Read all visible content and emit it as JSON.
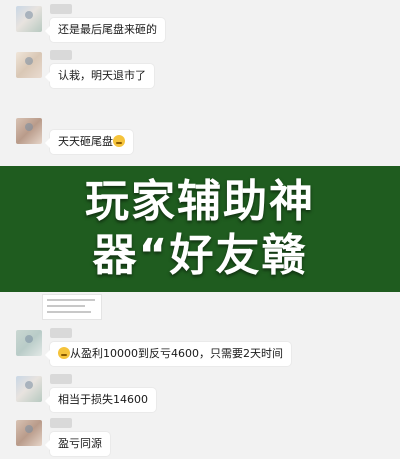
{
  "chat": {
    "messages": [
      {
        "text": "还是最后尾盘来砸的"
      },
      {
        "text": "认栽，明天退市了"
      },
      {
        "text": "天天砸尾盘",
        "emoji_after": "grinning-sweat-emoji"
      },
      {
        "text": "从盈利10000到反亏4600，只需要2天时间",
        "emoji_before": "grinning-sweat-emoji"
      },
      {
        "text": "相当于损失14600"
      },
      {
        "text": "盈亏同源"
      }
    ]
  },
  "banner": {
    "background": "#1f5c1f",
    "line1": "玩家辅助神",
    "line2": "器“好友赣"
  }
}
